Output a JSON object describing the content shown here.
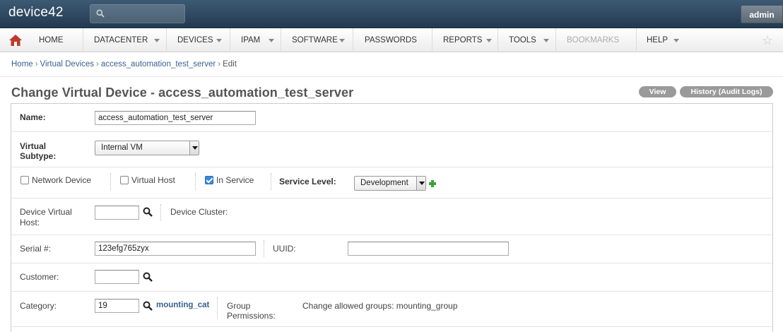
{
  "header": {
    "logo": "device42",
    "search_placeholder": "",
    "user_button": "admin"
  },
  "nav": {
    "items": [
      {
        "label": "HOME"
      },
      {
        "label": "DATACENTER"
      },
      {
        "label": "DEVICES"
      },
      {
        "label": "IPAM"
      },
      {
        "label": "SOFTWARE"
      },
      {
        "label": "PASSWORDS"
      },
      {
        "label": "REPORTS"
      },
      {
        "label": "TOOLS"
      },
      {
        "label": "BOOKMARKS"
      },
      {
        "label": "HELP"
      }
    ]
  },
  "breadcrumb": {
    "items": [
      "Home",
      "Virtual Devices",
      "access_automation_test_server"
    ],
    "current": "Edit",
    "separator": "›"
  },
  "page": {
    "title": "Change Virtual Device - access_automation_test_server",
    "view_button": "View",
    "history_button": "History (Audit Logs)"
  },
  "form": {
    "name_label": "Name:",
    "name_value": "access_automation_test_server",
    "subtype_label": "Virtual Subtype:",
    "subtype_value": "Internal VM",
    "network_device_label": "Network Device",
    "network_device_checked": false,
    "virtual_host_label": "Virtual Host",
    "virtual_host_checked": false,
    "in_service_label": "In Service",
    "in_service_checked": true,
    "service_level_label": "Service Level:",
    "service_level_value": "Development",
    "device_virtual_host_label": "Device Virtual Host:",
    "device_virtual_host_value": "",
    "device_cluster_label": "Device Cluster:",
    "serial_label": "Serial #:",
    "serial_value": "123efg765zyx",
    "uuid_label": "UUID:",
    "uuid_value": "",
    "customer_label": "Customer:",
    "customer_value": "",
    "category_label": "Category:",
    "category_value": "19",
    "category_link": "mounting_cat",
    "group_permissions_label": "Group Permissions:",
    "group_permissions_value": "Change allowed groups: mounting_group"
  }
}
